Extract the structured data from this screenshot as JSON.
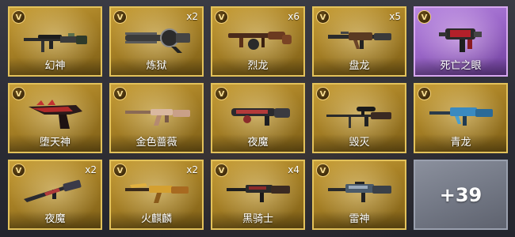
{
  "badge_letter": "V",
  "colors": {
    "gold_card": "#b08a2e",
    "gold_border": "#e3c25a",
    "purple_card": "#9b67c9",
    "gray_card": "#747986"
  },
  "items": [
    {
      "name": "幻神",
      "count": "",
      "rarity": "gold",
      "icon": "sniper-rifle-icon"
    },
    {
      "name": "炼狱",
      "count": "x2",
      "rarity": "gold",
      "icon": "gatling-gun-icon"
    },
    {
      "name": "烈龙",
      "count": "x6",
      "rarity": "gold",
      "icon": "tommy-gun-icon"
    },
    {
      "name": "盘龙",
      "count": "x5",
      "rarity": "gold",
      "icon": "assault-rifle-icon"
    },
    {
      "name": "死亡之眼",
      "count": "",
      "rarity": "purple",
      "icon": "smg-icon"
    },
    {
      "name": "堕天神",
      "count": "",
      "rarity": "gold",
      "icon": "heavy-pistol-icon"
    },
    {
      "name": "金色蔷薇",
      "count": "",
      "rarity": "gold",
      "icon": "ak-rifle-icon"
    },
    {
      "name": "夜魔",
      "count": "",
      "rarity": "gold",
      "icon": "shotgun-icon"
    },
    {
      "name": "毁灭",
      "count": "",
      "rarity": "gold",
      "icon": "sniper-rifle-icon"
    },
    {
      "name": "青龙",
      "count": "",
      "rarity": "gold",
      "icon": "assault-rifle-icon"
    },
    {
      "name": "夜魔",
      "count": "x2",
      "rarity": "gold",
      "icon": "assault-rifle-icon"
    },
    {
      "name": "火麒麟",
      "count": "x2",
      "rarity": "gold",
      "icon": "ak-rifle-icon"
    },
    {
      "name": "黑骑士",
      "count": "x4",
      "rarity": "gold",
      "icon": "assault-rifle-icon"
    },
    {
      "name": "雷神",
      "count": "",
      "rarity": "gold",
      "icon": "m4-rifle-icon"
    }
  ],
  "more_tile": {
    "label": "+39"
  }
}
